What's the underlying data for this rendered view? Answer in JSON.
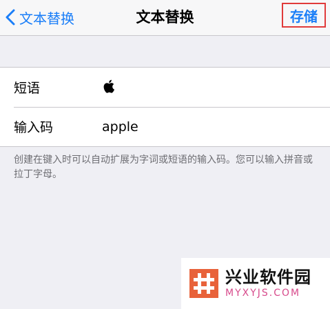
{
  "navbar": {
    "back_label": "文本替换",
    "title": "文本替换",
    "save_label": "存储"
  },
  "form": {
    "rows": [
      {
        "label": "短语",
        "value_icon": "apple-logo-icon"
      },
      {
        "label": "输入码",
        "value": "apple"
      }
    ],
    "footer": "创建在键入时可以自动扩展为字词或短语的输入码。您可以输入拼音或拉丁字母。"
  },
  "watermark": {
    "title": "兴业软件园",
    "url": "MYXYJS.COM"
  },
  "colors": {
    "accent": "#1a7ef8",
    "highlight_border": "#e03a3a",
    "background": "#efeff4"
  }
}
